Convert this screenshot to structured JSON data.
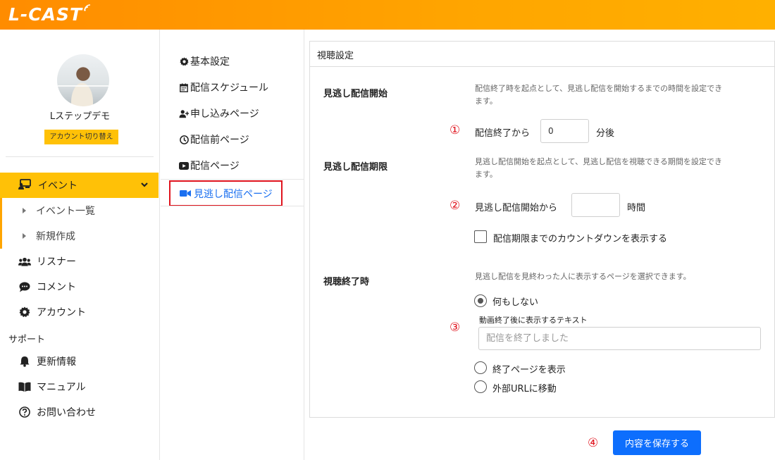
{
  "header": {
    "logo_text": "L-CAST"
  },
  "sidebar": {
    "username": "Lステップデモ",
    "switch_account": "アカウント切り替え",
    "event": {
      "label": "イベント"
    },
    "event_sub": [
      {
        "label": "イベント一覧"
      },
      {
        "label": "新規作成"
      }
    ],
    "items": [
      {
        "label": "リスナー"
      },
      {
        "label": "コメント"
      },
      {
        "label": "アカウント"
      }
    ],
    "support_label": "サポート",
    "support_items": [
      {
        "label": "更新情報"
      },
      {
        "label": "マニュアル"
      },
      {
        "label": "お問い合わせ"
      }
    ]
  },
  "midmenu": {
    "items": [
      {
        "label": "基本設定"
      },
      {
        "label": "配信スケジュール"
      },
      {
        "label": "申し込みページ"
      },
      {
        "label": "配信前ページ"
      },
      {
        "label": "配信ページ"
      }
    ],
    "active_label": "見逃し配信ページ"
  },
  "card": {
    "title": "視聴設定",
    "start": {
      "title": "見逃し配信開始",
      "desc_line1": "配信終了時を起点として、見逃し配信を開始するまでの時間を設定でき",
      "desc_line2": "ます。",
      "marker": "①",
      "prefix": "配信終了から",
      "value": "0",
      "suffix": "分後"
    },
    "deadline": {
      "title": "見逃し配信期限",
      "desc_line1": "見逃し配信開始を起点として、見逃し配信を視聴できる期間を設定でき",
      "desc_line2": "ます。",
      "marker": "②",
      "prefix": "見逃し配信開始から",
      "value": "",
      "suffix": "時間",
      "countdown_label": "配信期限までのカウントダウンを表示する"
    },
    "end": {
      "title": "視聴終了時",
      "desc": "見逃し配信を見終わった人に表示するページを選択できます。",
      "marker": "③",
      "option_none": "何もしない",
      "text_label": "動画終了後に表示するテキスト",
      "text_placeholder": "配信を終了しました",
      "option_end_page": "終了ページを表示",
      "option_url": "外部URLに移動"
    }
  },
  "footer": {
    "marker": "④",
    "save_label": "内容を保存する"
  },
  "colors": {
    "accent_orange": "#ffa500",
    "highlight_yellow": "#ffc107",
    "primary_blue": "#0d6efd",
    "annotation_red": "#e0141e"
  }
}
